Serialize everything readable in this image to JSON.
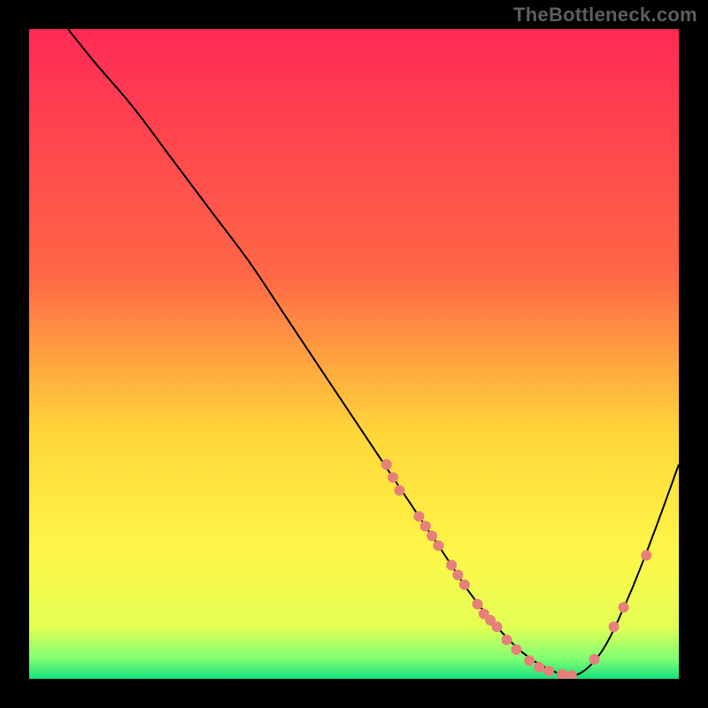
{
  "watermark": "TheBottleneck.com",
  "chart_data": {
    "type": "line",
    "title": "",
    "xlabel": "",
    "ylabel": "",
    "xlim": [
      0,
      100
    ],
    "ylim": [
      0,
      100
    ],
    "background_gradient": {
      "stops": [
        {
          "offset": 0,
          "color": "#ff2a55"
        },
        {
          "offset": 38,
          "color": "#ff6846"
        },
        {
          "offset": 62,
          "color": "#ffd63a"
        },
        {
          "offset": 80,
          "color": "#fff547"
        },
        {
          "offset": 92,
          "color": "#e3ff54"
        },
        {
          "offset": 97,
          "color": "#7dff74"
        },
        {
          "offset": 100,
          "color": "#16e07b"
        }
      ]
    },
    "series": [
      {
        "name": "bottleneck-curve",
        "x": [
          6,
          10,
          16,
          22,
          28,
          34,
          40,
          46,
          52,
          56,
          60,
          64,
          68,
          72,
          76,
          80,
          84,
          88,
          92,
          96,
          100
        ],
        "y": [
          100,
          95,
          88,
          80,
          72,
          64,
          55,
          46,
          37,
          31,
          25,
          19,
          13,
          8,
          4,
          1.5,
          0.5,
          4,
          12,
          22,
          33
        ]
      }
    ],
    "markers": {
      "name": "highlight-points",
      "color": "#e77f7b",
      "radius": 6,
      "points": [
        {
          "x": 55,
          "y": 33
        },
        {
          "x": 56,
          "y": 31
        },
        {
          "x": 57,
          "y": 29
        },
        {
          "x": 60,
          "y": 25
        },
        {
          "x": 61,
          "y": 23.5
        },
        {
          "x": 62,
          "y": 22
        },
        {
          "x": 63,
          "y": 20.5
        },
        {
          "x": 65,
          "y": 17.5
        },
        {
          "x": 66,
          "y": 16
        },
        {
          "x": 67,
          "y": 14.5
        },
        {
          "x": 69,
          "y": 11.5
        },
        {
          "x": 70,
          "y": 10
        },
        {
          "x": 71,
          "y": 9
        },
        {
          "x": 72,
          "y": 8
        },
        {
          "x": 73.5,
          "y": 6
        },
        {
          "x": 75,
          "y": 4.5
        },
        {
          "x": 77,
          "y": 2.8
        },
        {
          "x": 78.5,
          "y": 1.8
        },
        {
          "x": 80,
          "y": 1.2
        },
        {
          "x": 82,
          "y": 0.7
        },
        {
          "x": 83.5,
          "y": 0.5
        },
        {
          "x": 87,
          "y": 3
        },
        {
          "x": 90,
          "y": 8
        },
        {
          "x": 91.5,
          "y": 11
        },
        {
          "x": 95,
          "y": 19
        }
      ]
    }
  }
}
